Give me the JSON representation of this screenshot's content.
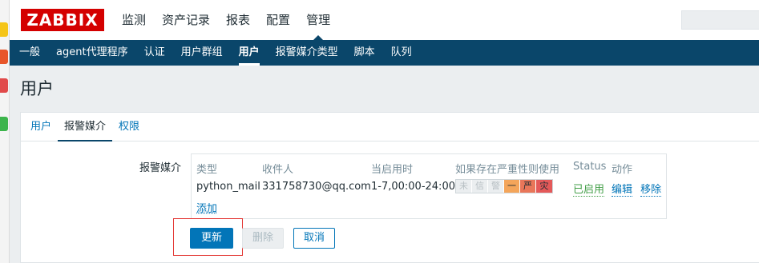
{
  "header": {
    "logo": "ZABBIX",
    "main_nav": [
      {
        "label": "监测",
        "active": false
      },
      {
        "label": "资产记录",
        "active": false
      },
      {
        "label": "报表",
        "active": false
      },
      {
        "label": "配置",
        "active": false
      },
      {
        "label": "管理",
        "active": true
      }
    ]
  },
  "sub_nav": [
    {
      "label": "一般",
      "active": false
    },
    {
      "label": "agent代理程序",
      "active": false
    },
    {
      "label": "认证",
      "active": false
    },
    {
      "label": "用户群组",
      "active": false
    },
    {
      "label": "用户",
      "active": true
    },
    {
      "label": "报警媒介类型",
      "active": false
    },
    {
      "label": "脚本",
      "active": false
    },
    {
      "label": "队列",
      "active": false
    }
  ],
  "page": {
    "title": "用户",
    "tabs": [
      {
        "label": "用户",
        "active": false
      },
      {
        "label": "报警媒介",
        "active": true
      },
      {
        "label": "权限",
        "active": false
      }
    ]
  },
  "media": {
    "label": "报警媒介",
    "columns": {
      "type": "类型",
      "send_to": "收件人",
      "when_active": "当启用时",
      "severity": "如果存在严重性则使用",
      "status": "Status",
      "action": "动作"
    },
    "row": {
      "type": "python_mail",
      "send_to": "331758730@qq.com",
      "when_active": "1-7,00:00-24:00",
      "severity_labels": [
        "未",
        "信",
        "警",
        "一",
        "严",
        "灾"
      ],
      "severity_enabled": [
        false,
        false,
        false,
        true,
        true,
        true
      ],
      "status": "已启用",
      "edit": "编辑",
      "remove": "移除"
    },
    "add": "添加"
  },
  "buttons": {
    "update": "更新",
    "delete": "删除",
    "cancel": "取消"
  },
  "colors": {
    "accent": "#0275b8",
    "nav_bg": "#0a466a",
    "logo_bg": "#d40000",
    "enabled": "#429e47",
    "highlight_box": "#e33734"
  }
}
